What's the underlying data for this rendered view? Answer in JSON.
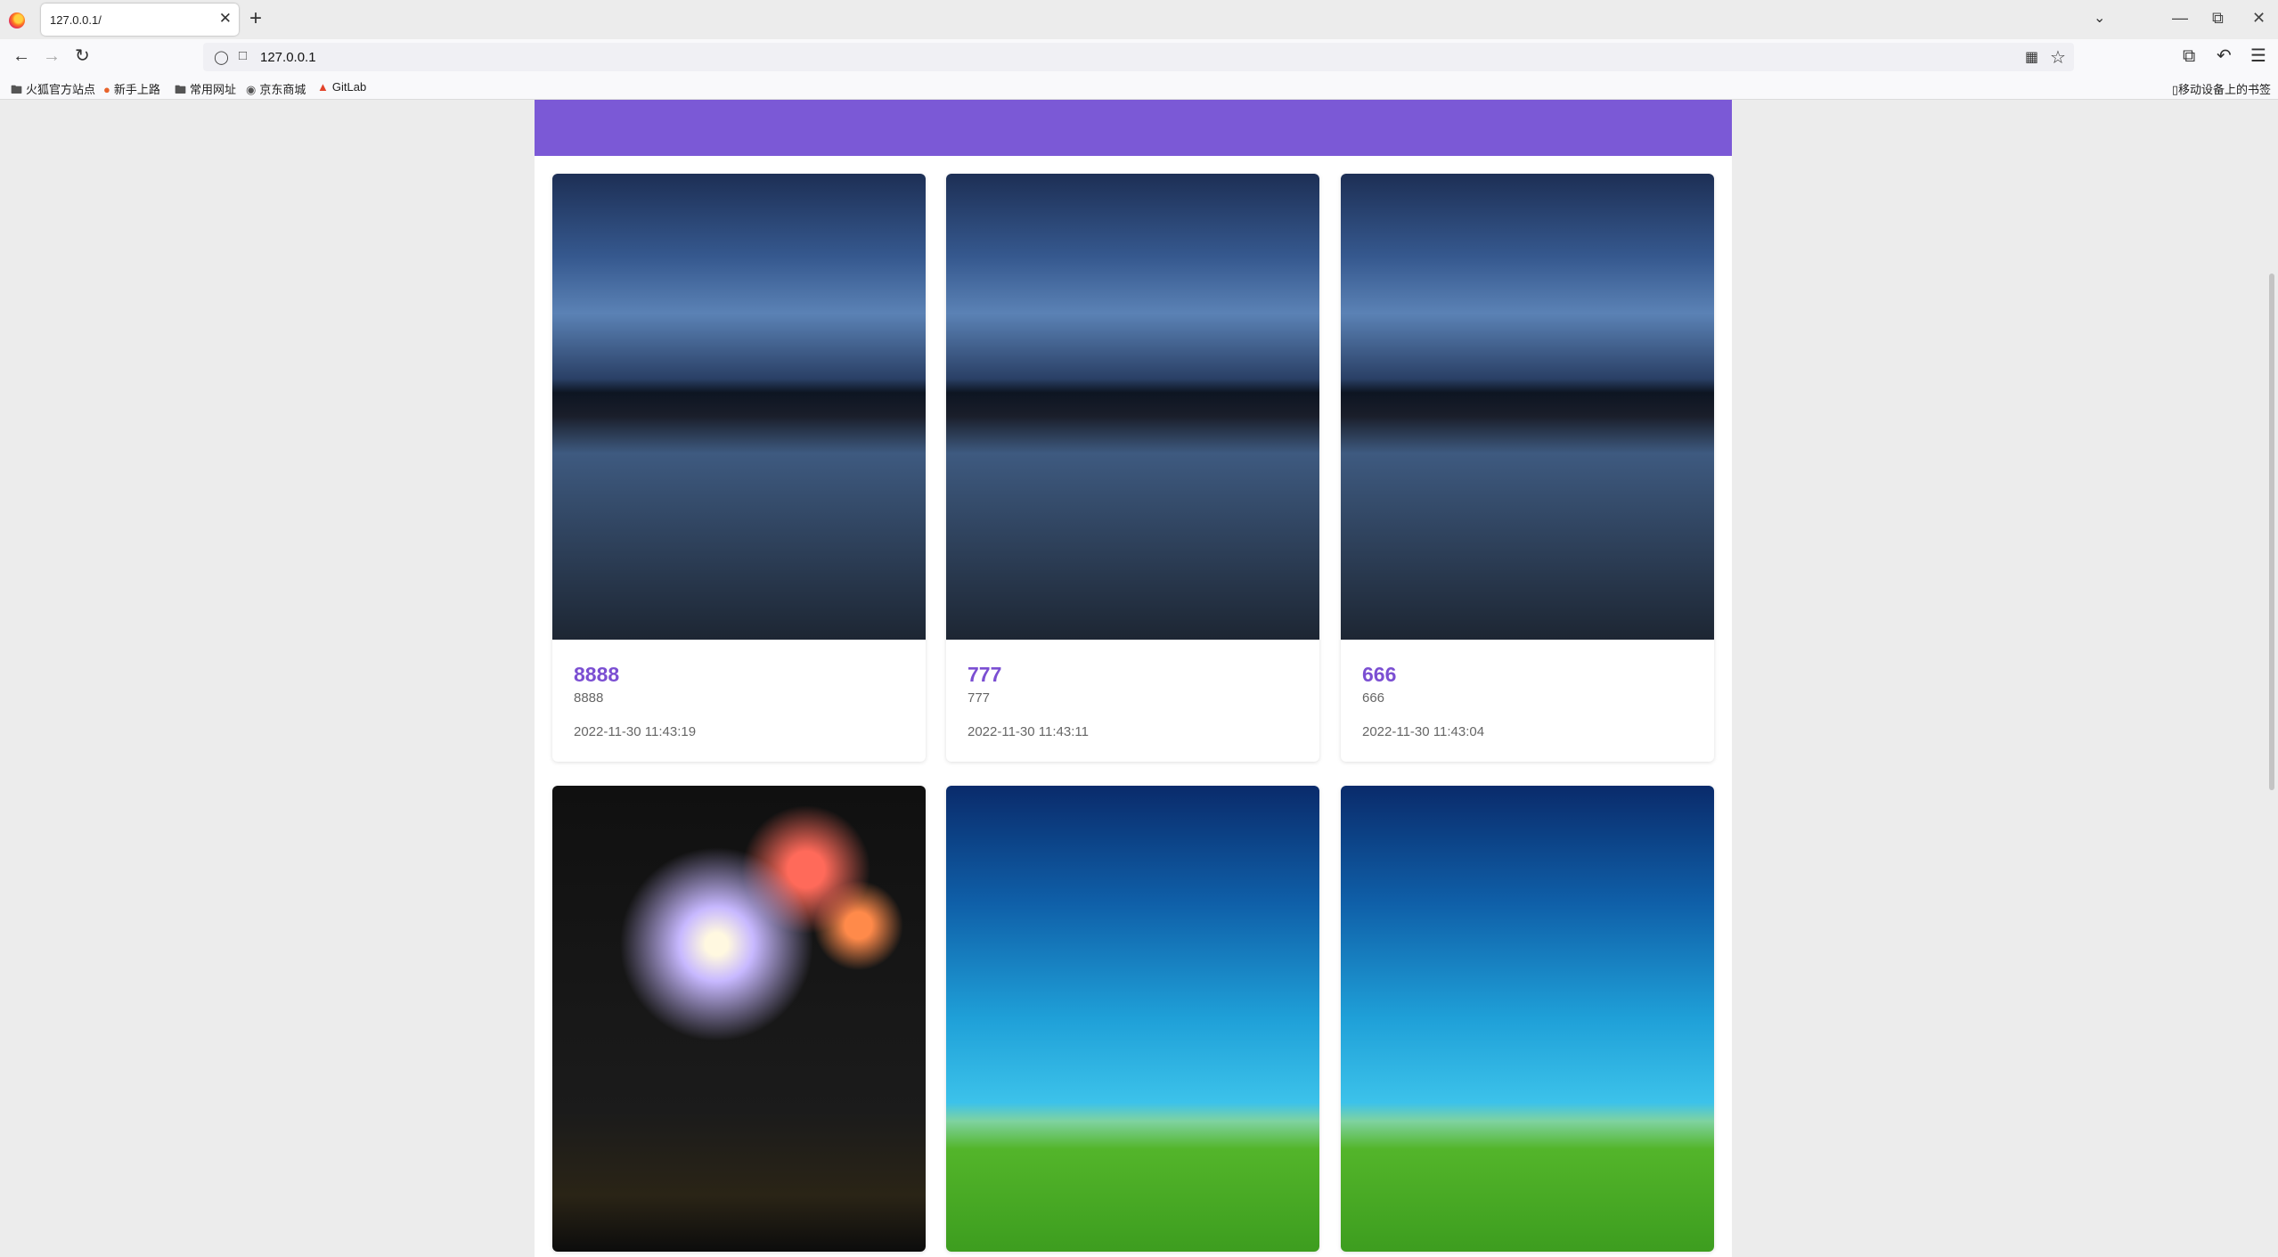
{
  "browser": {
    "tab_title": "127.0.0.1/",
    "tab_close": "✕",
    "new_tab": "+",
    "url": "127.0.0.1",
    "bookmarks": [
      {
        "label": "火狐官方站点",
        "icon": "folder-icon"
      },
      {
        "label": "新手上路",
        "icon": "firefox-icon"
      },
      {
        "label": "常用网址",
        "icon": "folder-icon"
      },
      {
        "label": "京东商城",
        "icon": "globe-icon"
      },
      {
        "label": "GitLab",
        "icon": "gitlab-icon"
      }
    ],
    "mobile_bookmarks": "移动设备上的书签"
  },
  "page": {
    "header_color": "#7b59d6",
    "accent_color": "#7b4fd2",
    "cards": [
      {
        "title": "8888",
        "subtitle": "8888",
        "date": "2022-11-30 11:43:19",
        "image": "night-pier-photo"
      },
      {
        "title": "777",
        "subtitle": "777",
        "date": "2022-11-30 11:43:11",
        "image": "night-pier-photo"
      },
      {
        "title": "666",
        "subtitle": "666",
        "date": "2022-11-30 11:43:04",
        "image": "night-pier-photo"
      },
      {
        "image": "fireworks-photo"
      },
      {
        "image": "hot-air-balloons-photo"
      },
      {
        "image": "hot-air-balloons-photo"
      }
    ]
  }
}
